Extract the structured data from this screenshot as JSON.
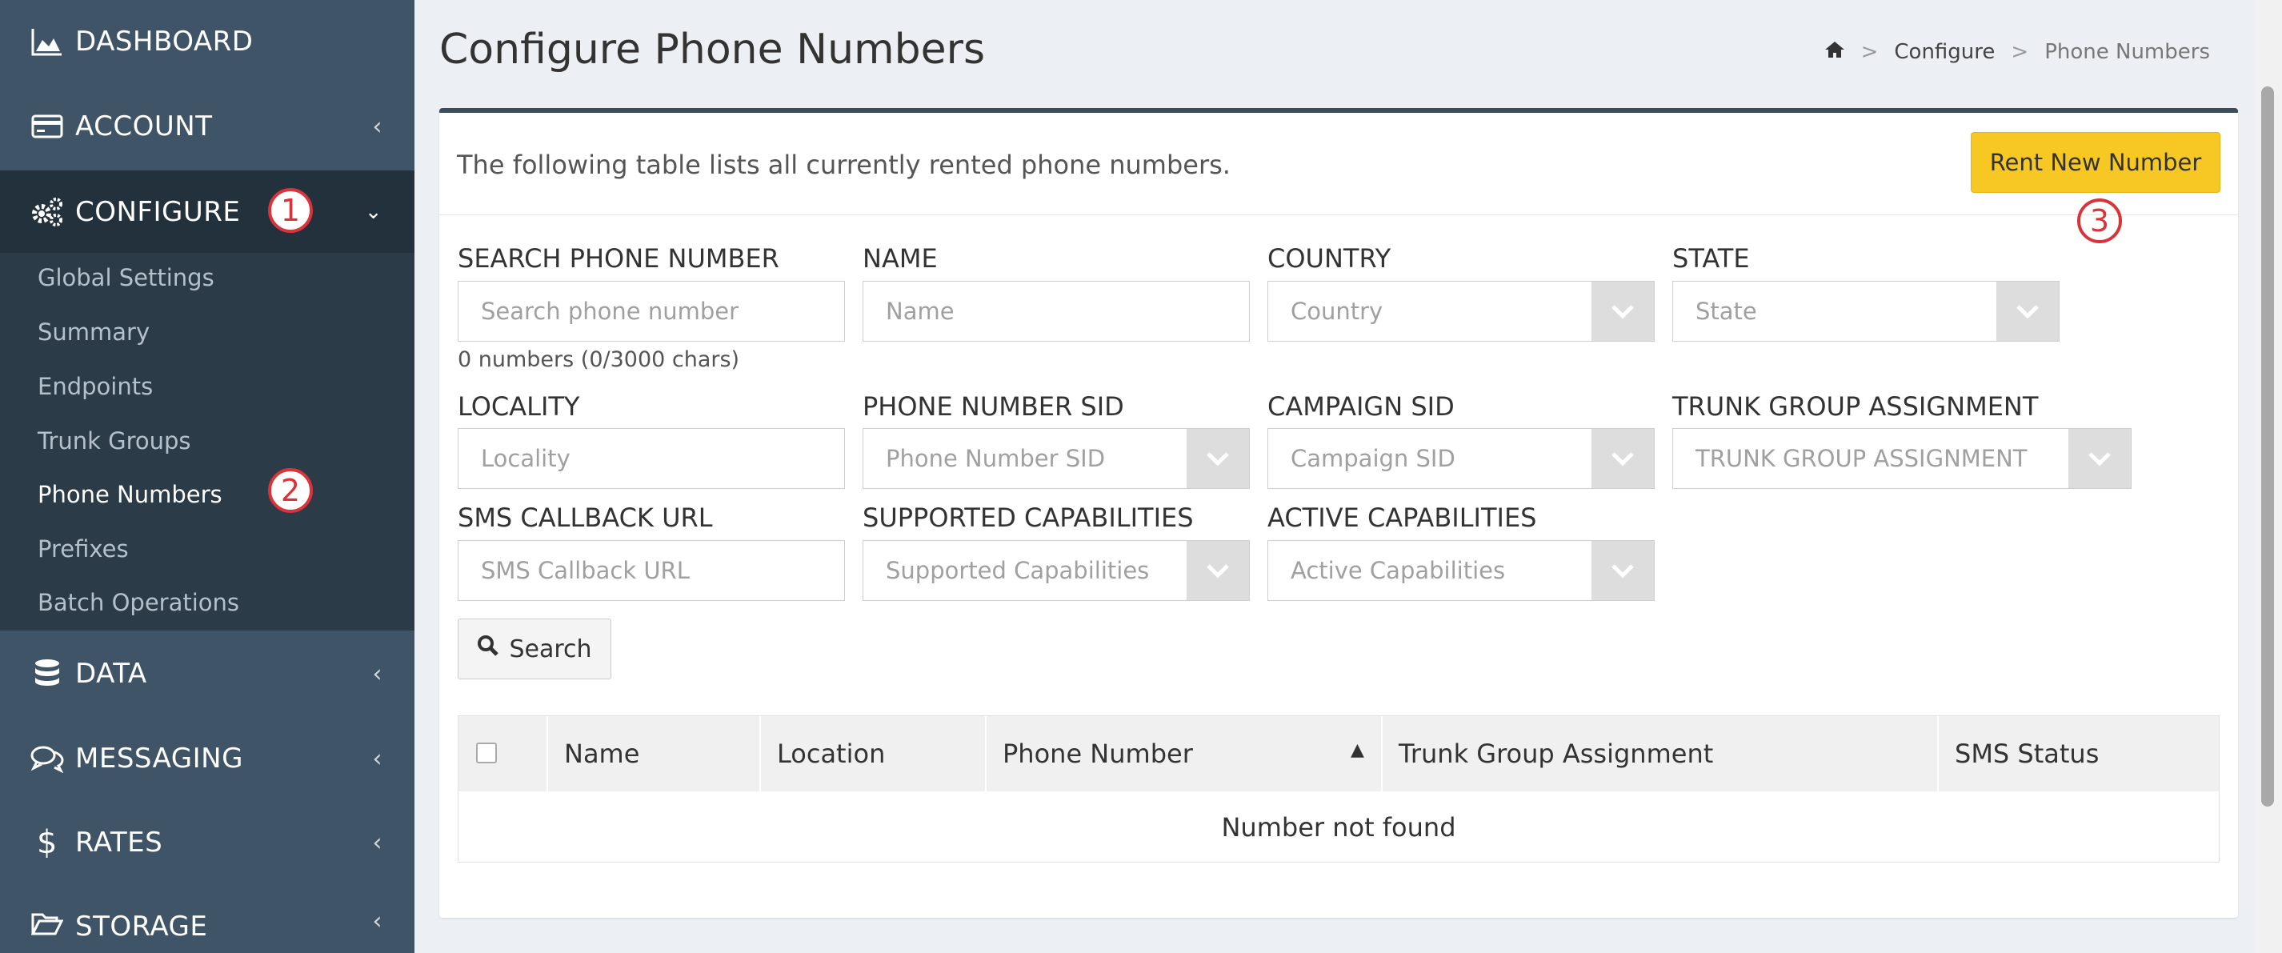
{
  "sidebar": {
    "items": [
      {
        "label": "DASHBOARD",
        "icon": "area-chart-icon"
      },
      {
        "label": "ACCOUNT",
        "icon": "credit-card-icon"
      },
      {
        "label": "CONFIGURE",
        "icon": "gears-icon"
      },
      {
        "label": "DATA",
        "icon": "database-icon"
      },
      {
        "label": "MESSAGING",
        "icon": "chat-bubbles-icon"
      },
      {
        "label": "RATES",
        "icon": "dollar-icon"
      },
      {
        "label": "STORAGE",
        "icon": "folder-open-icon"
      }
    ],
    "submenu": [
      "Global Settings",
      "Summary",
      "Endpoints",
      "Trunk Groups",
      "Phone Numbers",
      "Prefixes",
      "Batch Operations"
    ]
  },
  "annotations": [
    "1",
    "2",
    "3"
  ],
  "header": {
    "title": "Configure Phone Numbers",
    "breadcrumb": {
      "home_icon": "home-icon",
      "sep": ">",
      "configure": "Configure",
      "current": "Phone Numbers"
    }
  },
  "box": {
    "description": "The following table lists all currently rented phone numbers.",
    "rent_button": "Rent New Number"
  },
  "filters": {
    "search_phone": {
      "label": "SEARCH PHONE NUMBER",
      "placeholder": "Search phone number",
      "hint": "0 numbers (0/3000 chars)"
    },
    "name": {
      "label": "NAME",
      "placeholder": "Name"
    },
    "country": {
      "label": "COUNTRY",
      "placeholder": "Country"
    },
    "state": {
      "label": "STATE",
      "placeholder": "State"
    },
    "locality": {
      "label": "LOCALITY",
      "placeholder": "Locality"
    },
    "phone_sid": {
      "label": "PHONE NUMBER SID",
      "placeholder": "Phone Number SID"
    },
    "campaign_sid": {
      "label": "CAMPAIGN SID",
      "placeholder": "Campaign SID"
    },
    "trunk_group": {
      "label": "TRUNK GROUP ASSIGNMENT",
      "placeholder": "TRUNK GROUP ASSIGNMENT"
    },
    "sms_callback": {
      "label": "SMS CALLBACK URL",
      "placeholder": "SMS Callback URL"
    },
    "supported_caps": {
      "label": "SUPPORTED CAPABILITIES",
      "placeholder": "Supported Capabilities"
    },
    "active_caps": {
      "label": "ACTIVE CAPABILITIES",
      "placeholder": "Active Capabilities"
    },
    "search_button": "Search"
  },
  "table": {
    "columns": [
      "Name",
      "Location",
      "Phone Number",
      "Trunk Group Assignment",
      "SMS Status"
    ],
    "sort_indicator": "▲",
    "empty_message": "Number not found"
  },
  "colors": {
    "sidebar": "#3f5466",
    "sidebar_active": "#22313c",
    "accent_button": "#f7c824",
    "annotation": "#d9343a"
  }
}
